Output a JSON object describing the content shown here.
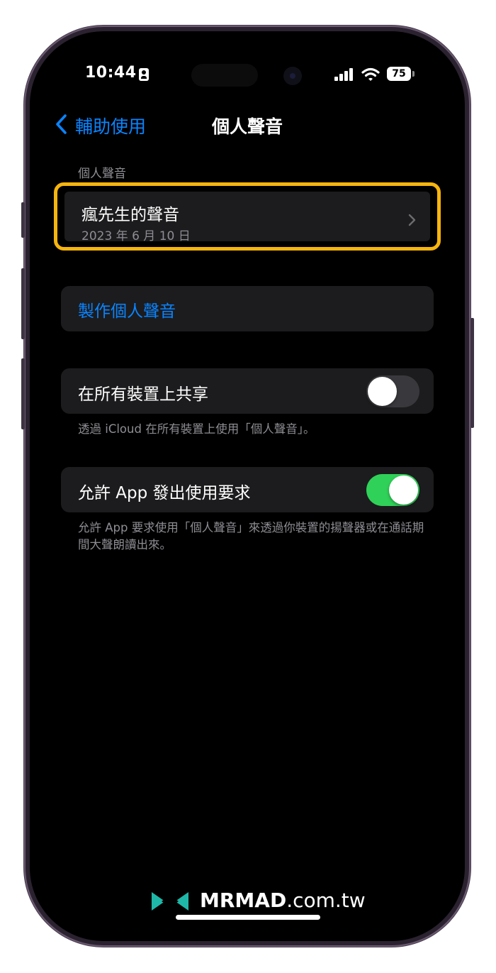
{
  "status_bar": {
    "time": "10:44",
    "battery_level": "75",
    "icons": [
      "id-card-icon",
      "signal-icon",
      "wifi-icon",
      "battery-icon"
    ]
  },
  "nav": {
    "back_label": "輔助使用",
    "title": "個人聲音"
  },
  "voices_section": {
    "header": "個人聲音",
    "items": [
      {
        "name": "瘋先生的聲音",
        "date": "2023 年 6 月 10 日"
      }
    ],
    "highlight_color": "#f6b40e"
  },
  "create_button": {
    "label": "製作個人聲音"
  },
  "share_setting": {
    "label": "在所有裝置上共享",
    "enabled": false,
    "footnote": "透過 iCloud 在所有裝置上使用「個人聲音」。"
  },
  "app_request_setting": {
    "label": "允許 App 發出使用要求",
    "enabled": true,
    "footnote": "允許 App 要求使用「個人聲音」來透過你裝置的揚聲器或在通話期間大聲朗讀出來。"
  },
  "watermark": {
    "brand": "MRMAD",
    "domain": ".com.tw"
  },
  "colors": {
    "accent": "#0a84ff",
    "toggle_on": "#30d158",
    "toggle_off": "#39393d",
    "cell_bg": "#1c1c1e",
    "secondary_text": "#8d8d93"
  }
}
